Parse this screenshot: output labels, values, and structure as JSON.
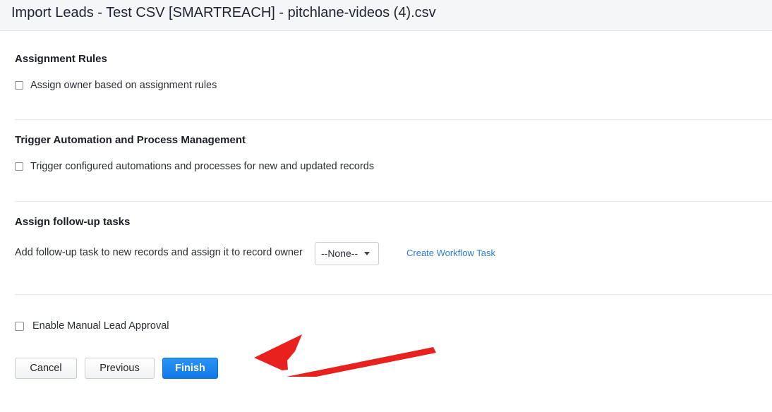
{
  "header": {
    "title": "Import Leads - Test CSV [SMARTREACH] - pitchlane-videos (4).csv"
  },
  "assignment_rules": {
    "title": "Assignment Rules",
    "checkbox_label": "Assign owner based on assignment rules"
  },
  "trigger_automation": {
    "title": "Trigger Automation and Process Management",
    "checkbox_label": "Trigger configured automations and processes for new and updated records"
  },
  "follow_up": {
    "title": "Assign follow-up tasks",
    "description": "Add follow-up task to new records and assign it to record owner",
    "select_value": "--None--",
    "link_label": "Create Workflow Task"
  },
  "manual_approval": {
    "checkbox_label": "Enable Manual Lead Approval"
  },
  "buttons": {
    "cancel": "Cancel",
    "previous": "Previous",
    "finish": "Finish"
  },
  "colors": {
    "accent": "#1a84f0",
    "link": "#2b7bd8",
    "annotation_arrow": "#e8201e"
  },
  "icons": {
    "dropdown": "chevron-down-icon",
    "annotation": "arrow-annotation-icon"
  }
}
